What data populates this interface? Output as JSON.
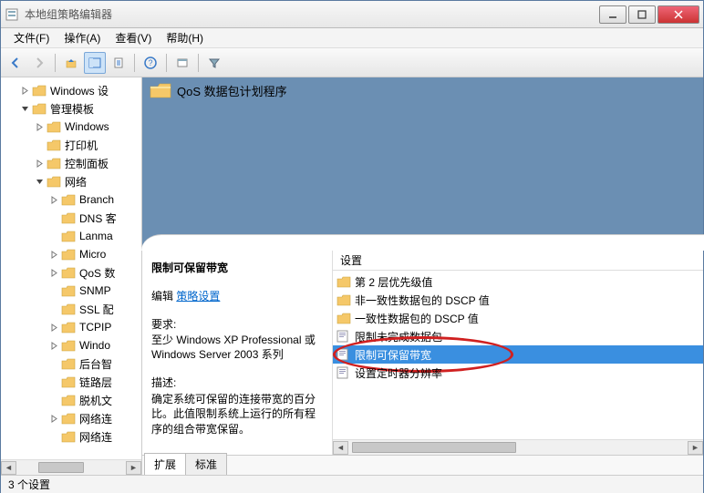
{
  "window": {
    "title": "本地组策略编辑器"
  },
  "menu": {
    "file": "文件(F)",
    "action": "操作(A)",
    "view": "查看(V)",
    "help": "帮助(H)"
  },
  "tree": {
    "items": [
      {
        "indent": 1,
        "exp": "right",
        "label": "Windows 设"
      },
      {
        "indent": 1,
        "exp": "down",
        "label": "管理模板"
      },
      {
        "indent": 2,
        "exp": "right",
        "label": "Windows"
      },
      {
        "indent": 2,
        "exp": "",
        "label": "打印机"
      },
      {
        "indent": 2,
        "exp": "right",
        "label": "控制面板"
      },
      {
        "indent": 2,
        "exp": "down",
        "label": "网络"
      },
      {
        "indent": 3,
        "exp": "right",
        "label": "Branch"
      },
      {
        "indent": 3,
        "exp": "",
        "label": "DNS 客"
      },
      {
        "indent": 3,
        "exp": "",
        "label": "Lanma"
      },
      {
        "indent": 3,
        "exp": "right",
        "label": "Micro"
      },
      {
        "indent": 3,
        "exp": "right",
        "label": "QoS 数"
      },
      {
        "indent": 3,
        "exp": "",
        "label": "SNMP"
      },
      {
        "indent": 3,
        "exp": "",
        "label": "SSL 配"
      },
      {
        "indent": 3,
        "exp": "right",
        "label": "TCPIP"
      },
      {
        "indent": 3,
        "exp": "right",
        "label": "Windo"
      },
      {
        "indent": 3,
        "exp": "",
        "label": "后台智"
      },
      {
        "indent": 3,
        "exp": "",
        "label": "链路层"
      },
      {
        "indent": 3,
        "exp": "",
        "label": "脱机文"
      },
      {
        "indent": 3,
        "exp": "right",
        "label": "网络连"
      },
      {
        "indent": 3,
        "exp": "",
        "label": "网络连"
      }
    ]
  },
  "header": {
    "title": "QoS 数据包计划程序"
  },
  "detail": {
    "title": "限制可保留带宽",
    "edit_prefix": "编辑 ",
    "edit_link": "策略设置",
    "requirements_label": "要求:",
    "requirements_text": "至少 Windows XP Professional 或 Windows Server 2003 系列",
    "description_label": "描述:",
    "description_text": "确定系统可保留的连接带宽的百分比。此值限制系统上运行的所有程序的组合带宽保留。"
  },
  "settings": {
    "column": "设置",
    "items": [
      {
        "type": "folder",
        "label": "第 2 层优先级值"
      },
      {
        "type": "folder",
        "label": "非一致性数据包的 DSCP 值"
      },
      {
        "type": "folder",
        "label": "一致性数据包的 DSCP 值"
      },
      {
        "type": "policy",
        "label": "限制未完成数据包"
      },
      {
        "type": "policy",
        "label": "限制可保留带宽",
        "selected": true,
        "circled": true
      },
      {
        "type": "policy",
        "label": "设置定时器分辨率"
      }
    ]
  },
  "tabs": {
    "extended": "扩展",
    "standard": "标准"
  },
  "status": {
    "text": "3 个设置"
  }
}
